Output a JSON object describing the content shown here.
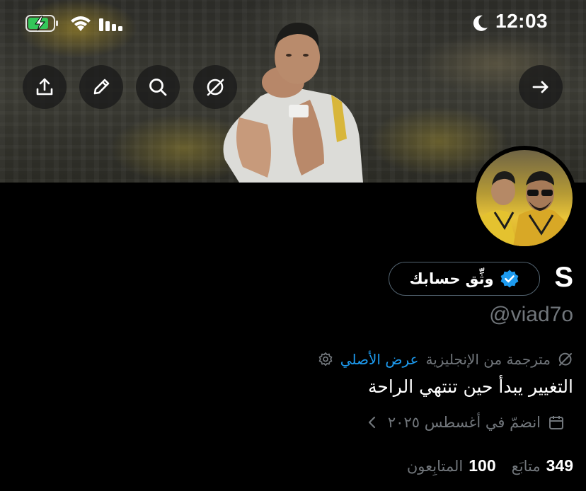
{
  "status_bar": {
    "time": "12:03"
  },
  "header": {
    "icons": [
      "share-icon",
      "edit-icon",
      "search-icon",
      "translate-icon",
      "back-arrow-icon"
    ]
  },
  "profile": {
    "name": "S",
    "verify_label": "وثِّق حسابك",
    "handle": "@viad7o",
    "translated_from": "مترجمة من الإنجليزية",
    "show_original": "عرض الأصلي",
    "bio": "التغيير يبدأ حين تنتهي الراحة",
    "joined": "انضمّ في أغسطس ٢٠٢٥",
    "following_count": "349",
    "following_label": "متابَع",
    "followers_count": "100",
    "followers_label": "المتابِعون"
  },
  "colors": {
    "accent": "#1d9bf0",
    "muted": "#71767b",
    "battery": "#34c759",
    "background": "#000000"
  }
}
